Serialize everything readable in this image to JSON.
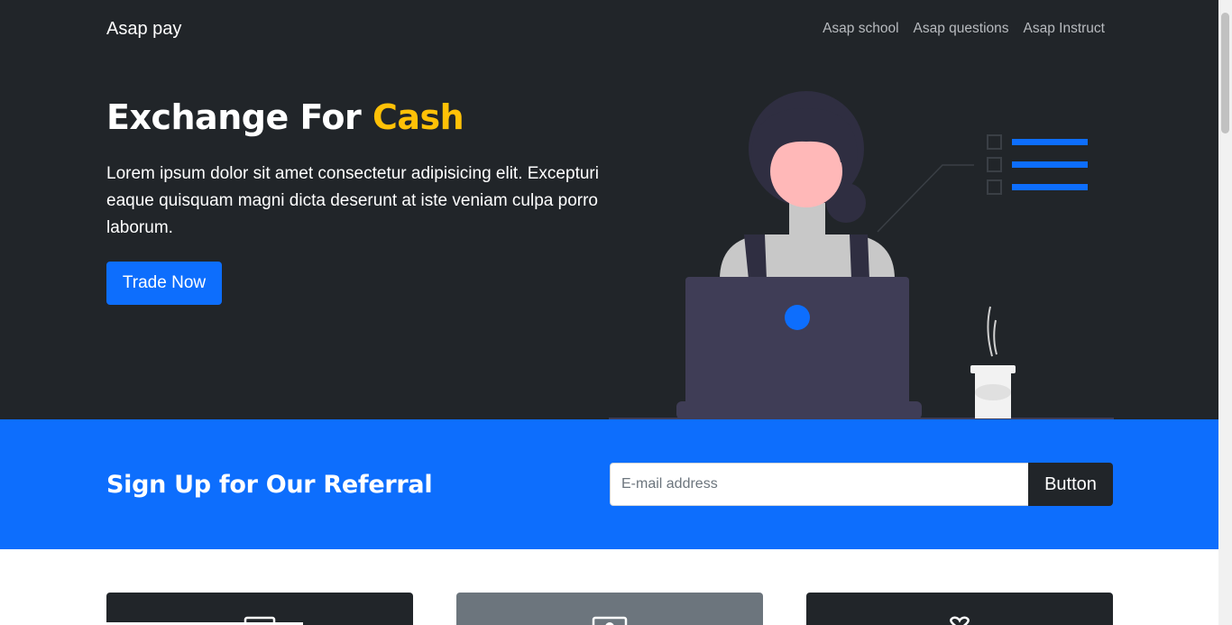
{
  "navbar": {
    "brand": "Asap pay",
    "links": [
      "Asap school",
      "Asap questions",
      "Asap Instruct"
    ]
  },
  "hero": {
    "title_main": "Exchange For ",
    "title_accent": "Cash",
    "text": "Lorem ipsum dolor sit amet consectetur adipisicing elit. Excepturi eaque quisquam magni dicta deserunt at iste veniam culpa porro laborum.",
    "cta_label": "Trade Now"
  },
  "referral": {
    "title": "Sign Up for Our Referral",
    "email_placeholder": "E-mail address",
    "button_label": "Button"
  },
  "colors": {
    "dark": "#212529",
    "primary": "#0d6efd",
    "accent": "#ffc107",
    "secondary": "#6c757d"
  },
  "icons": [
    "laptop-icon",
    "profile-card-icon",
    "heart-icon"
  ]
}
